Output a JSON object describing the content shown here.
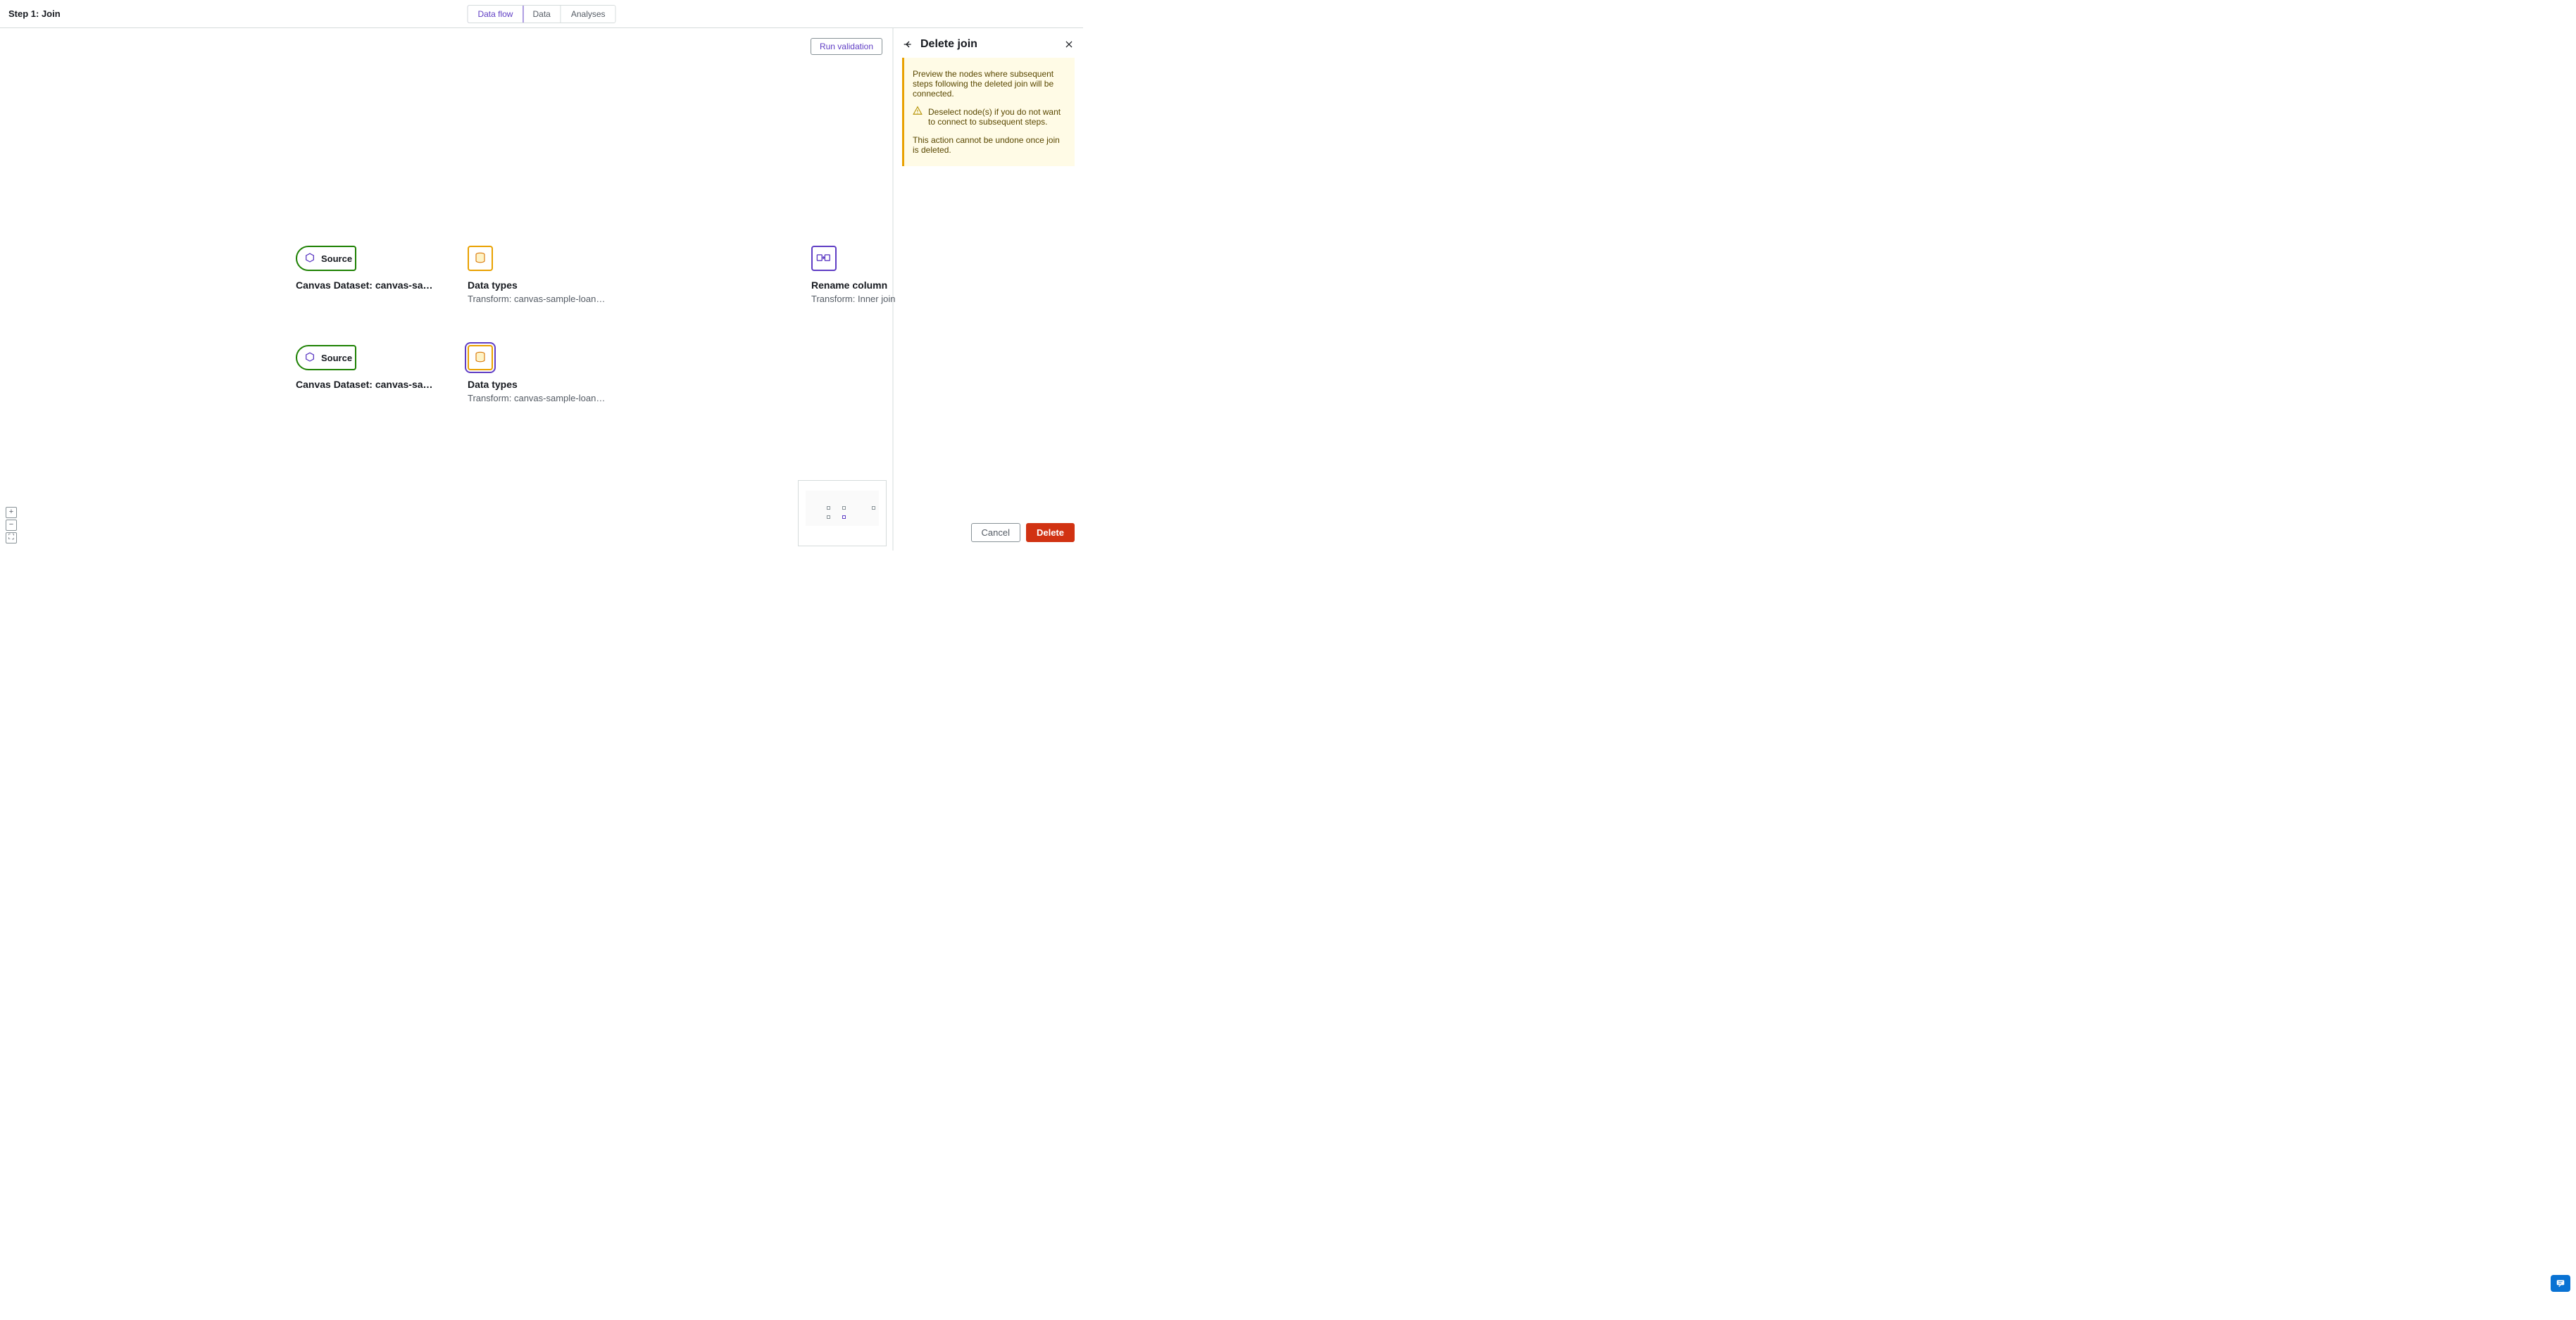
{
  "topbar": {
    "step_title": "Step 1: Join",
    "tabs": [
      "Data flow",
      "Data",
      "Analyses"
    ],
    "active_tab_index": 0
  },
  "canvas": {
    "run_validation_label": "Run validation",
    "nodes": {
      "source1": {
        "label": "Source",
        "title": "Canvas Dataset: canvas-sample-…"
      },
      "source2": {
        "label": "Source",
        "title": "Canvas Dataset: canvas-sample-…"
      },
      "datatypes1": {
        "title": "Data types",
        "sub": "Transform: canvas-sample-loans-part-…"
      },
      "datatypes2": {
        "title": "Data types",
        "sub": "Transform: canvas-sample-loans-part-…"
      },
      "rename": {
        "title": "Rename column",
        "sub": "Transform: Inner join"
      }
    }
  },
  "panel": {
    "title": "Delete join",
    "warning": {
      "line1": "Preview the nodes where subsequent steps following the deleted join will be connected.",
      "line2": "Deselect node(s) if you do not want to connect to subsequent steps.",
      "line3": "This action cannot be undone once join is deleted."
    },
    "cancel_label": "Cancel",
    "delete_label": "Delete"
  }
}
